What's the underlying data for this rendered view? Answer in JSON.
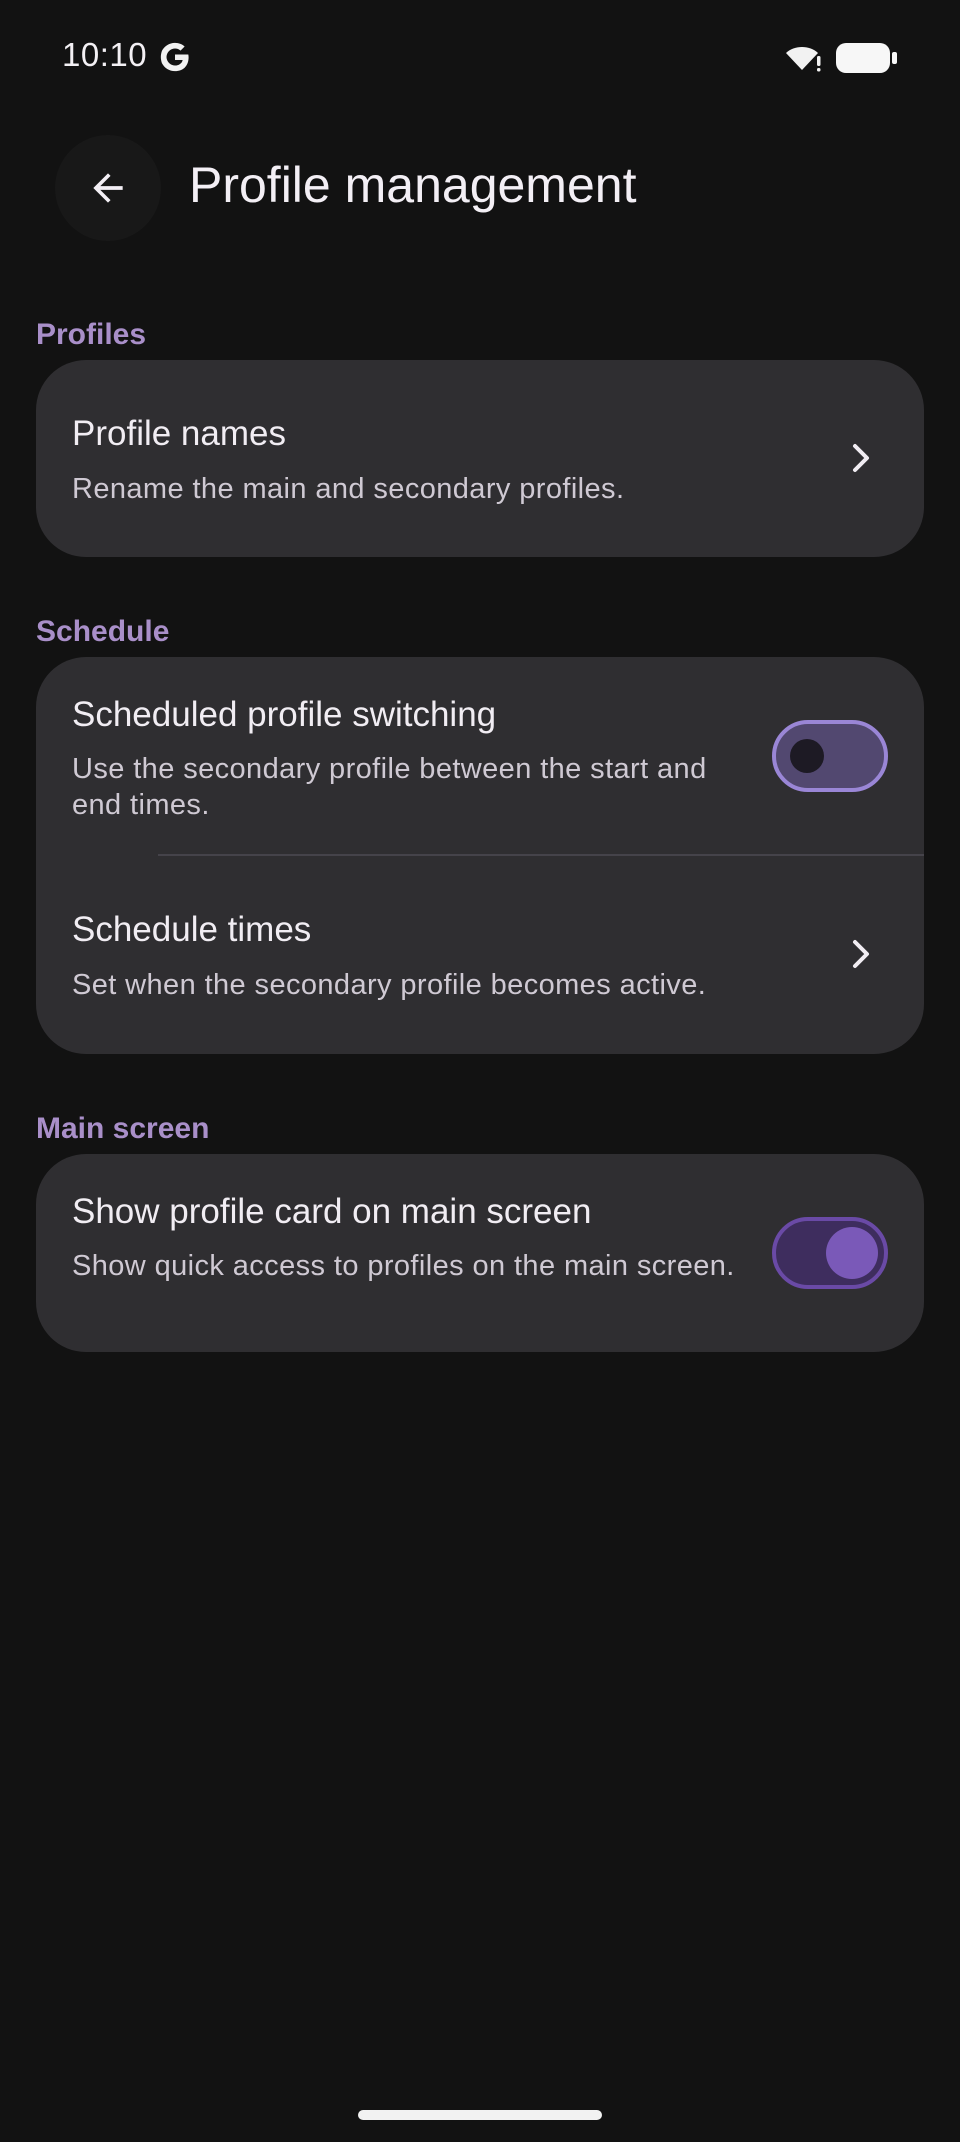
{
  "status_bar": {
    "time": "10:10"
  },
  "app_bar": {
    "title": "Profile management"
  },
  "sections": {
    "profiles": {
      "header": "Profiles",
      "profile_names": {
        "title": "Profile names",
        "subtitle": "Rename the main and secondary profiles."
      }
    },
    "schedule": {
      "header": "Schedule",
      "scheduled_switching": {
        "title": "Scheduled profile switching",
        "subtitle": "Use the secondary profile between the start and end times.",
        "enabled": false
      },
      "schedule_times": {
        "title": "Schedule times",
        "subtitle": "Set when the secondary profile becomes active."
      }
    },
    "main_screen": {
      "header": "Main screen",
      "show_profile_card": {
        "title": "Show profile card on main screen",
        "subtitle": "Show quick access to profiles on the main screen.",
        "enabled": true
      }
    }
  },
  "colors": {
    "background": "#121212",
    "card": "#2F2E31",
    "accent": "#A98FC9",
    "switch_on_thumb": "#7A59B8",
    "switch_off_track": "#524870"
  },
  "icons": {
    "google": "g-logo-icon",
    "wifi": "wifi-icon",
    "battery": "battery-icon",
    "back": "arrow-back-icon",
    "chevron": "chevron-right-icon"
  }
}
